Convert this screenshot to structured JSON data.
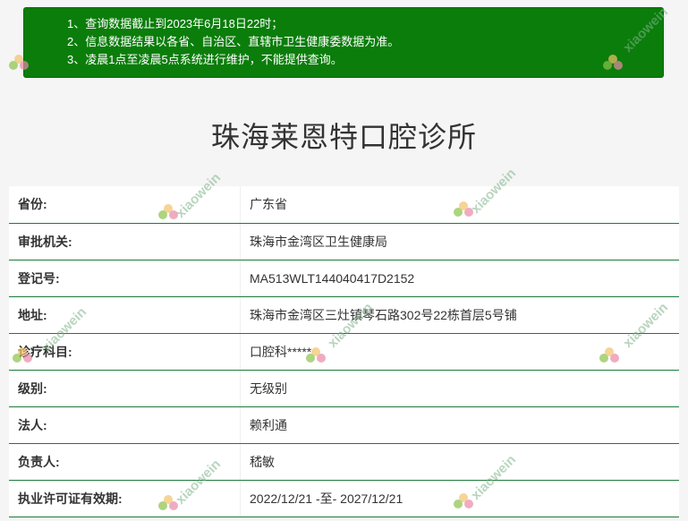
{
  "notice": {
    "lines": [
      "1、查询数据截止到2023年6月18日22时；",
      "2、信息数据结果以各省、自治区、直辖市卫生健康委数据为准。",
      "3、凌晨1点至凌晨5点系统进行维护，不能提供查询。"
    ]
  },
  "page": {
    "title": "珠海莱恩特口腔诊所"
  },
  "details": [
    {
      "label": "省份:",
      "value": "广东省"
    },
    {
      "label": "审批机关:",
      "value": "珠海市金湾区卫生健康局"
    },
    {
      "label": "登记号:",
      "value": "MA513WLT144040417D2152"
    },
    {
      "label": "地址:",
      "value": "珠海市金湾区三灶镇琴石路302号22栋首层5号铺"
    },
    {
      "label": "诊疗科目:",
      "value": "口腔科*****"
    },
    {
      "label": "级别:",
      "value": "无级别"
    },
    {
      "label": "法人:",
      "value": "赖利通"
    },
    {
      "label": "负责人:",
      "value": "嵇敏"
    },
    {
      "label": "执业许可证有效期:",
      "value": "2022/12/21 -至- 2027/12/21"
    }
  ],
  "watermark": {
    "text": "xiaowein",
    "icon": "flower-logo-icon",
    "color": "#7fb48a"
  }
}
